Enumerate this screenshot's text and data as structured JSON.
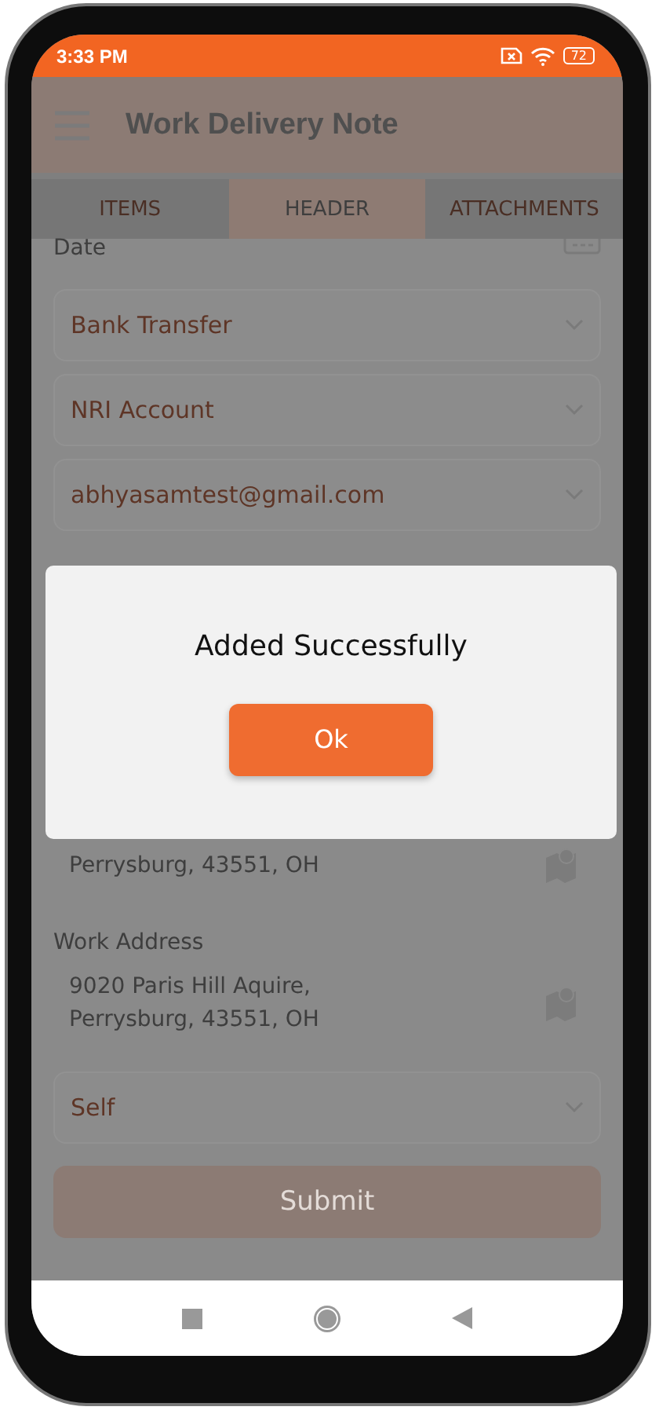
{
  "status_bar": {
    "time": "3:33 PM",
    "battery": "72"
  },
  "app_bar": {
    "title": "Work Delivery Note"
  },
  "tabs": [
    {
      "label": "ITEMS",
      "selected": false
    },
    {
      "label": "HEADER",
      "selected": true
    },
    {
      "label": "ATTACHMENTS",
      "selected": false
    }
  ],
  "fields": [
    {
      "kind": "date",
      "label": "Date"
    },
    {
      "kind": "select",
      "value": "Bank Transfer"
    },
    {
      "kind": "select",
      "value": "NRI Account"
    },
    {
      "kind": "select",
      "value": "abhyasamtest@gmail.com"
    },
    {
      "kind": "address",
      "lines": [
        "Perrysburg, 43551, OH"
      ]
    },
    {
      "kind": "address",
      "label": "Work Address",
      "lines": [
        "9020 Paris Hill Aquire,",
        "Perrysburg, 43551, OH"
      ]
    },
    {
      "kind": "select",
      "value": "Self"
    }
  ],
  "submit": {
    "label": "Submit"
  },
  "dialog": {
    "message": "Added Successfully",
    "button": "Ok"
  }
}
